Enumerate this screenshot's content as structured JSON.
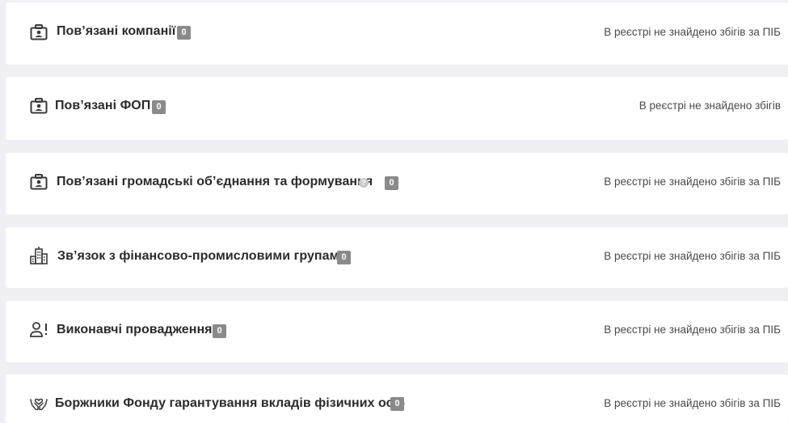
{
  "sections": [
    {
      "icon": "id-badge-icon",
      "title": "Пов’язані компанії",
      "count": "0",
      "status": "В реєстрі не знайдено збігів за ПІБ"
    },
    {
      "icon": "id-badge-icon",
      "title": "Пов’язані ФОП",
      "count": "0",
      "status": "В реєстрі не знайдено збігів"
    },
    {
      "icon": "id-badge-icon",
      "title": "Пов’язані громадські об’єднання та формування",
      "help": "?",
      "count": "0",
      "status": "В реєстрі не знайдено збігів за ПІБ"
    },
    {
      "icon": "buildings-icon",
      "title": "Зв’язок з фінансово-промисловими групами",
      "count": "0",
      "status": "В реєстрі не знайдено збігів за ПІБ"
    },
    {
      "icon": "person-alert-icon",
      "title": "Виконавчі провадження",
      "count": "0",
      "status": "В реєстрі не знайдено збігів за ПІБ"
    },
    {
      "icon": "hands-heart-icon",
      "title": "Боржники Фонду гарантування вкладів фізичних осіб",
      "count": "0",
      "status": "В реєстрі не знайдено збігів за ПІБ"
    }
  ]
}
